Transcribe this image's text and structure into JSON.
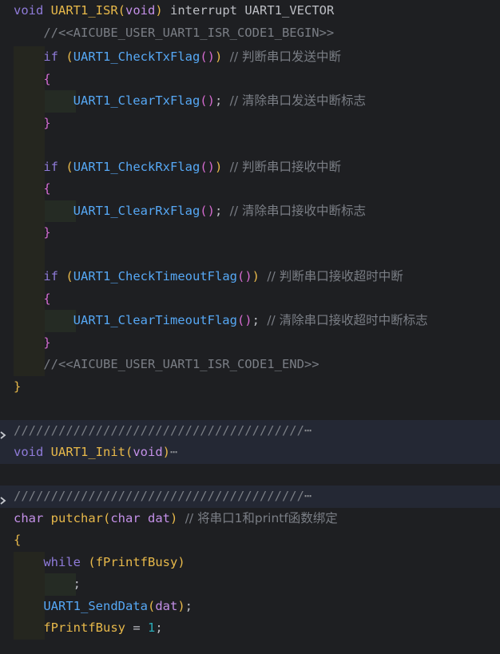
{
  "editor": {
    "background": "#1e1f22",
    "fold_icon": "chevron-right-icon",
    "lines": {
      "l01": {
        "t0": "void",
        "t1": " ",
        "t2": "UART1_ISR",
        "t3": "(",
        "t4": "void",
        "t5": ")",
        "t6": " interrupt UART1_VECTOR"
      },
      "l02": {
        "t0": "//<<AICUBE_USER_UART1_ISR_CODE1_BEGIN>>"
      },
      "l03": {
        "t0": "if",
        "t1": " ",
        "t2": "(",
        "t3": "UART1_CheckTxFlag",
        "t4": "()",
        "t5": ")",
        "t6": " ",
        "t7": "// 判断串口发送中断"
      },
      "l04": {
        "t0": "{"
      },
      "l05": {
        "t0": "UART1_ClearTxFlag",
        "t1": "()",
        "t2": "; ",
        "t3": "// 清除串口发送中断标志"
      },
      "l06": {
        "t0": "}"
      },
      "l08": {
        "t0": "if",
        "t1": " ",
        "t2": "(",
        "t3": "UART1_CheckRxFlag",
        "t4": "()",
        "t5": ")",
        "t6": " ",
        "t7": "// 判断串口接收中断"
      },
      "l09": {
        "t0": "{"
      },
      "l10": {
        "t0": "UART1_ClearRxFlag",
        "t1": "()",
        "t2": "; ",
        "t3": "// 清除串口接收中断标志"
      },
      "l11": {
        "t0": "}"
      },
      "l13": {
        "t0": "if",
        "t1": " ",
        "t2": "(",
        "t3": "UART1_CheckTimeoutFlag",
        "t4": "()",
        "t5": ")",
        "t6": " ",
        "t7": "// 判断串口接收超时中断"
      },
      "l14": {
        "t0": "{"
      },
      "l15": {
        "t0": "UART1_ClearTimeoutFlag",
        "t1": "()",
        "t2": "; ",
        "t3": "// 清除串口接收超时中断标志"
      },
      "l16": {
        "t0": "}"
      },
      "l17": {
        "t0": "//<<AICUBE_USER_UART1_ISR_CODE1_END>>"
      },
      "l18": {
        "t0": "}"
      },
      "l20": {
        "t0": "///////////////////////////////////////",
        "t1": "⋯"
      },
      "l21": {
        "t0": "void",
        "t1": " ",
        "t2": "UART1_Init",
        "t3": "(",
        "t4": "void",
        "t5": ")",
        "t6": "⋯"
      },
      "l23": {
        "t0": "///////////////////////////////////////",
        "t1": "⋯"
      },
      "l24": {
        "t0": "char",
        "t1": " ",
        "t2": "putchar",
        "t3": "(",
        "t4": "char",
        "t5": " ",
        "t6": "dat",
        "t7": ")",
        "t8": " ",
        "t9": "// 将串口1和printf函数绑定"
      },
      "l25": {
        "t0": "{"
      },
      "l26": {
        "t0": "while",
        "t1": " ",
        "t2": "(",
        "t3": "fPrintfBusy",
        "t4": ")"
      },
      "l27": {
        "t0": ";"
      },
      "l28": {
        "t0": "UART1_SendData",
        "t1": "(",
        "t2": "dat",
        "t3": ")",
        "t4": ";"
      },
      "l29": {
        "t0": "fPrintfBusy",
        "t1": " = ",
        "t2": "1",
        "t3": ";"
      }
    }
  }
}
